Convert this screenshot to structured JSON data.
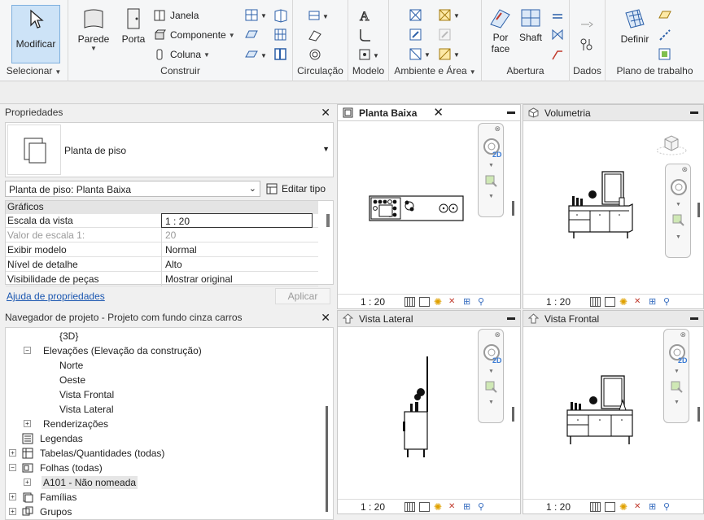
{
  "ribbon": {
    "selecionar": {
      "modificar": "Modificar",
      "label": "Selecionar"
    },
    "construir": {
      "parede": "Parede",
      "porta": "Porta",
      "janela": "Janela",
      "componente": "Componente",
      "coluna": "Coluna",
      "label": "Construir"
    },
    "circulacao": {
      "label": "Circulação"
    },
    "modelo": {
      "label": "Modelo"
    },
    "ambiente": {
      "label": "Ambiente e Área"
    },
    "abertura": {
      "por_face_1": "Por",
      "por_face_2": "face",
      "shaft": "Shaft",
      "label": "Abertura"
    },
    "dados": {
      "label": "Dados"
    },
    "plano": {
      "definir": "Definir",
      "label": "Plano de trabalho"
    }
  },
  "properties": {
    "title": "Propriedades",
    "type_name": "Planta de piso",
    "instance_selector": "Planta de piso: Planta Baixa",
    "edit_type": "Editar tipo",
    "section": "Gráficos",
    "rows": [
      {
        "key": "Escala da vista",
        "value": "1 : 20"
      },
      {
        "key": "Valor de escala    1:",
        "value": "20"
      },
      {
        "key": "Exibir modelo",
        "value": "Normal"
      },
      {
        "key": "Nível de detalhe",
        "value": "Alto"
      },
      {
        "key": "Visibilidade de peças",
        "value": "Mostrar original"
      }
    ],
    "help_link": "Ajuda de propriedades",
    "apply": "Aplicar"
  },
  "navigator": {
    "title": "Navegador de projeto - Projeto com fundo cinza carros",
    "items": [
      "{3D}",
      "Elevações (Elevação da construção)",
      "Norte",
      "Oeste",
      "Vista Frontal",
      "Vista Lateral",
      "Renderizações",
      "Legendas",
      "Tabelas/Quantidades (todas)",
      "Folhas (todas)",
      "A101 - Não nomeada",
      "Famílias",
      "Grupos"
    ]
  },
  "views": {
    "planta": {
      "title": "Planta Baixa",
      "scale": "1 : 20",
      "badge": "2D"
    },
    "volumetria": {
      "title": "Volumetria",
      "scale": "1 : 20"
    },
    "lateral": {
      "title": "Vista Lateral",
      "scale": "1 : 20",
      "badge": "2D"
    },
    "frontal": {
      "title": "Vista Frontal",
      "scale": "1 : 20",
      "badge": "2D"
    }
  },
  "colors": {
    "accent": "#cde3f7",
    "link": "#1a56b0",
    "tab_active": "#ffffff"
  }
}
